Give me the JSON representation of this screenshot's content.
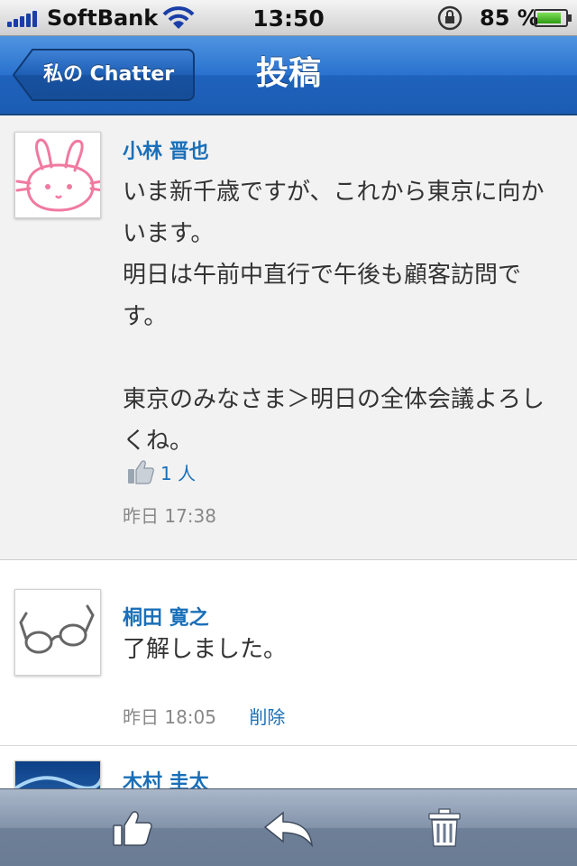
{
  "status_bar": {
    "carrier": "SoftBank",
    "time": "13:50",
    "battery_percent": "85 %",
    "battery_level": 0.85,
    "icons": [
      "signal-icon",
      "wifi-icon",
      "orientation-lock-icon",
      "battery-icon"
    ]
  },
  "nav": {
    "back_label": "私の Chatter",
    "title": "投稿"
  },
  "post": {
    "author": "小林 晋也",
    "body": "いま新千歳ですが、これから東京に向かいます。\n明日は午前中直行で午後も顧客訪問です。\n\n東京のみなさま＞明日の全体会議よろしくね。",
    "likes": "1 人",
    "timestamp": "昨日 17:38"
  },
  "comments": [
    {
      "author": "桐田 寛之",
      "body": "了解しました。",
      "timestamp": "昨日 18:05",
      "delete_label": "削除"
    },
    {
      "author": "木村 圭太"
    }
  ],
  "toolbar": {
    "icons": [
      "like-icon",
      "reply-icon",
      "trash-icon"
    ]
  },
  "colors": {
    "nav_blue": "#2a72cf",
    "link_blue": "#1a6fb8",
    "toolbar": "#8393aa"
  }
}
